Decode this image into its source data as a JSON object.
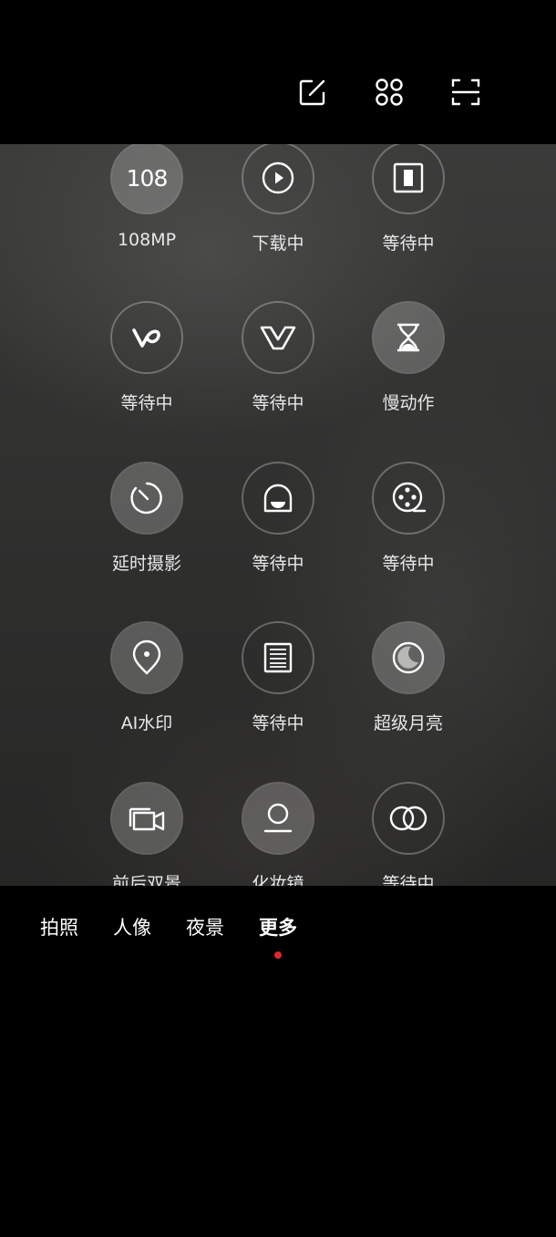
{
  "header": {
    "edit_icon": "edit-icon",
    "apps_icon": "grid-four-icon",
    "scan_icon": "scan-frame-icon"
  },
  "modes": [
    {
      "label": "108MP",
      "icon": "108",
      "style": "filled"
    },
    {
      "label": "下载中",
      "icon": "play-icon",
      "style": "outline"
    },
    {
      "label": "等待中",
      "icon": "frame-icon",
      "style": "outline"
    },
    {
      "label": "等待中",
      "icon": "v-logo-icon",
      "style": "outline"
    },
    {
      "label": "等待中",
      "icon": "v-outline-icon",
      "style": "outline"
    },
    {
      "label": "慢动作",
      "icon": "hourglass-icon",
      "style": "filled"
    },
    {
      "label": "延时摄影",
      "icon": "timer-dial-icon",
      "style": "filled"
    },
    {
      "label": "等待中",
      "icon": "ghost-face-icon",
      "style": "outline"
    },
    {
      "label": "等待中",
      "icon": "film-reel-icon",
      "style": "outline"
    },
    {
      "label": "AI水印",
      "icon": "location-pin-icon",
      "style": "filled"
    },
    {
      "label": "等待中",
      "icon": "document-lines-icon",
      "style": "outline"
    },
    {
      "label": "超级月亮",
      "icon": "moon-icon",
      "style": "filled"
    },
    {
      "label": "前后双景",
      "icon": "dual-video-icon",
      "style": "filled"
    },
    {
      "label": "化妆镜",
      "icon": "mirror-icon",
      "style": "filled"
    },
    {
      "label": "等待中",
      "icon": "two-circles-icon",
      "style": "outline"
    }
  ],
  "tabs": {
    "photo": "拍照",
    "portrait": "人像",
    "night": "夜景",
    "more": "更多",
    "active": "more"
  },
  "colors": {
    "accent_dot": "#e0262d"
  }
}
